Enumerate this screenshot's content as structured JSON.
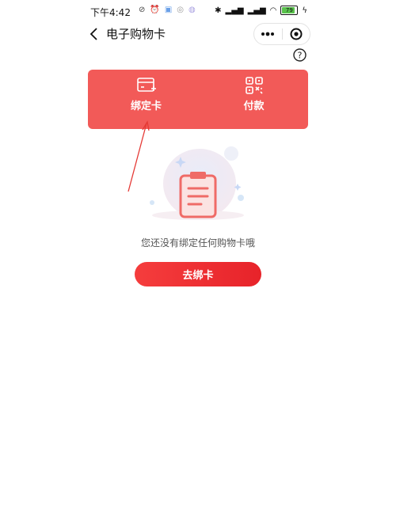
{
  "status_bar": {
    "time": "下午4:42",
    "battery": "79",
    "mini_icons": [
      "alarm-off-icon",
      "clock-icon",
      "app-icon",
      "app-icon",
      "app-icon"
    ]
  },
  "header": {
    "title": "电子购物卡",
    "back_icon": "chevron-left-icon",
    "more_icon": "more-dots-icon",
    "close_icon": "target-circle-icon"
  },
  "help_icon": "question-circle-icon",
  "card": {
    "bind_label": "绑定卡",
    "pay_label": "付款",
    "bind_icon": "card-add-icon",
    "pay_icon": "qrcode-icon",
    "color": "#f25a58"
  },
  "empty": {
    "message": "您还没有绑定任何购物卡哦",
    "illustration_icon": "clipboard-icon"
  },
  "action": {
    "go_bind_label": "去绑卡",
    "color": "#e7232a"
  }
}
